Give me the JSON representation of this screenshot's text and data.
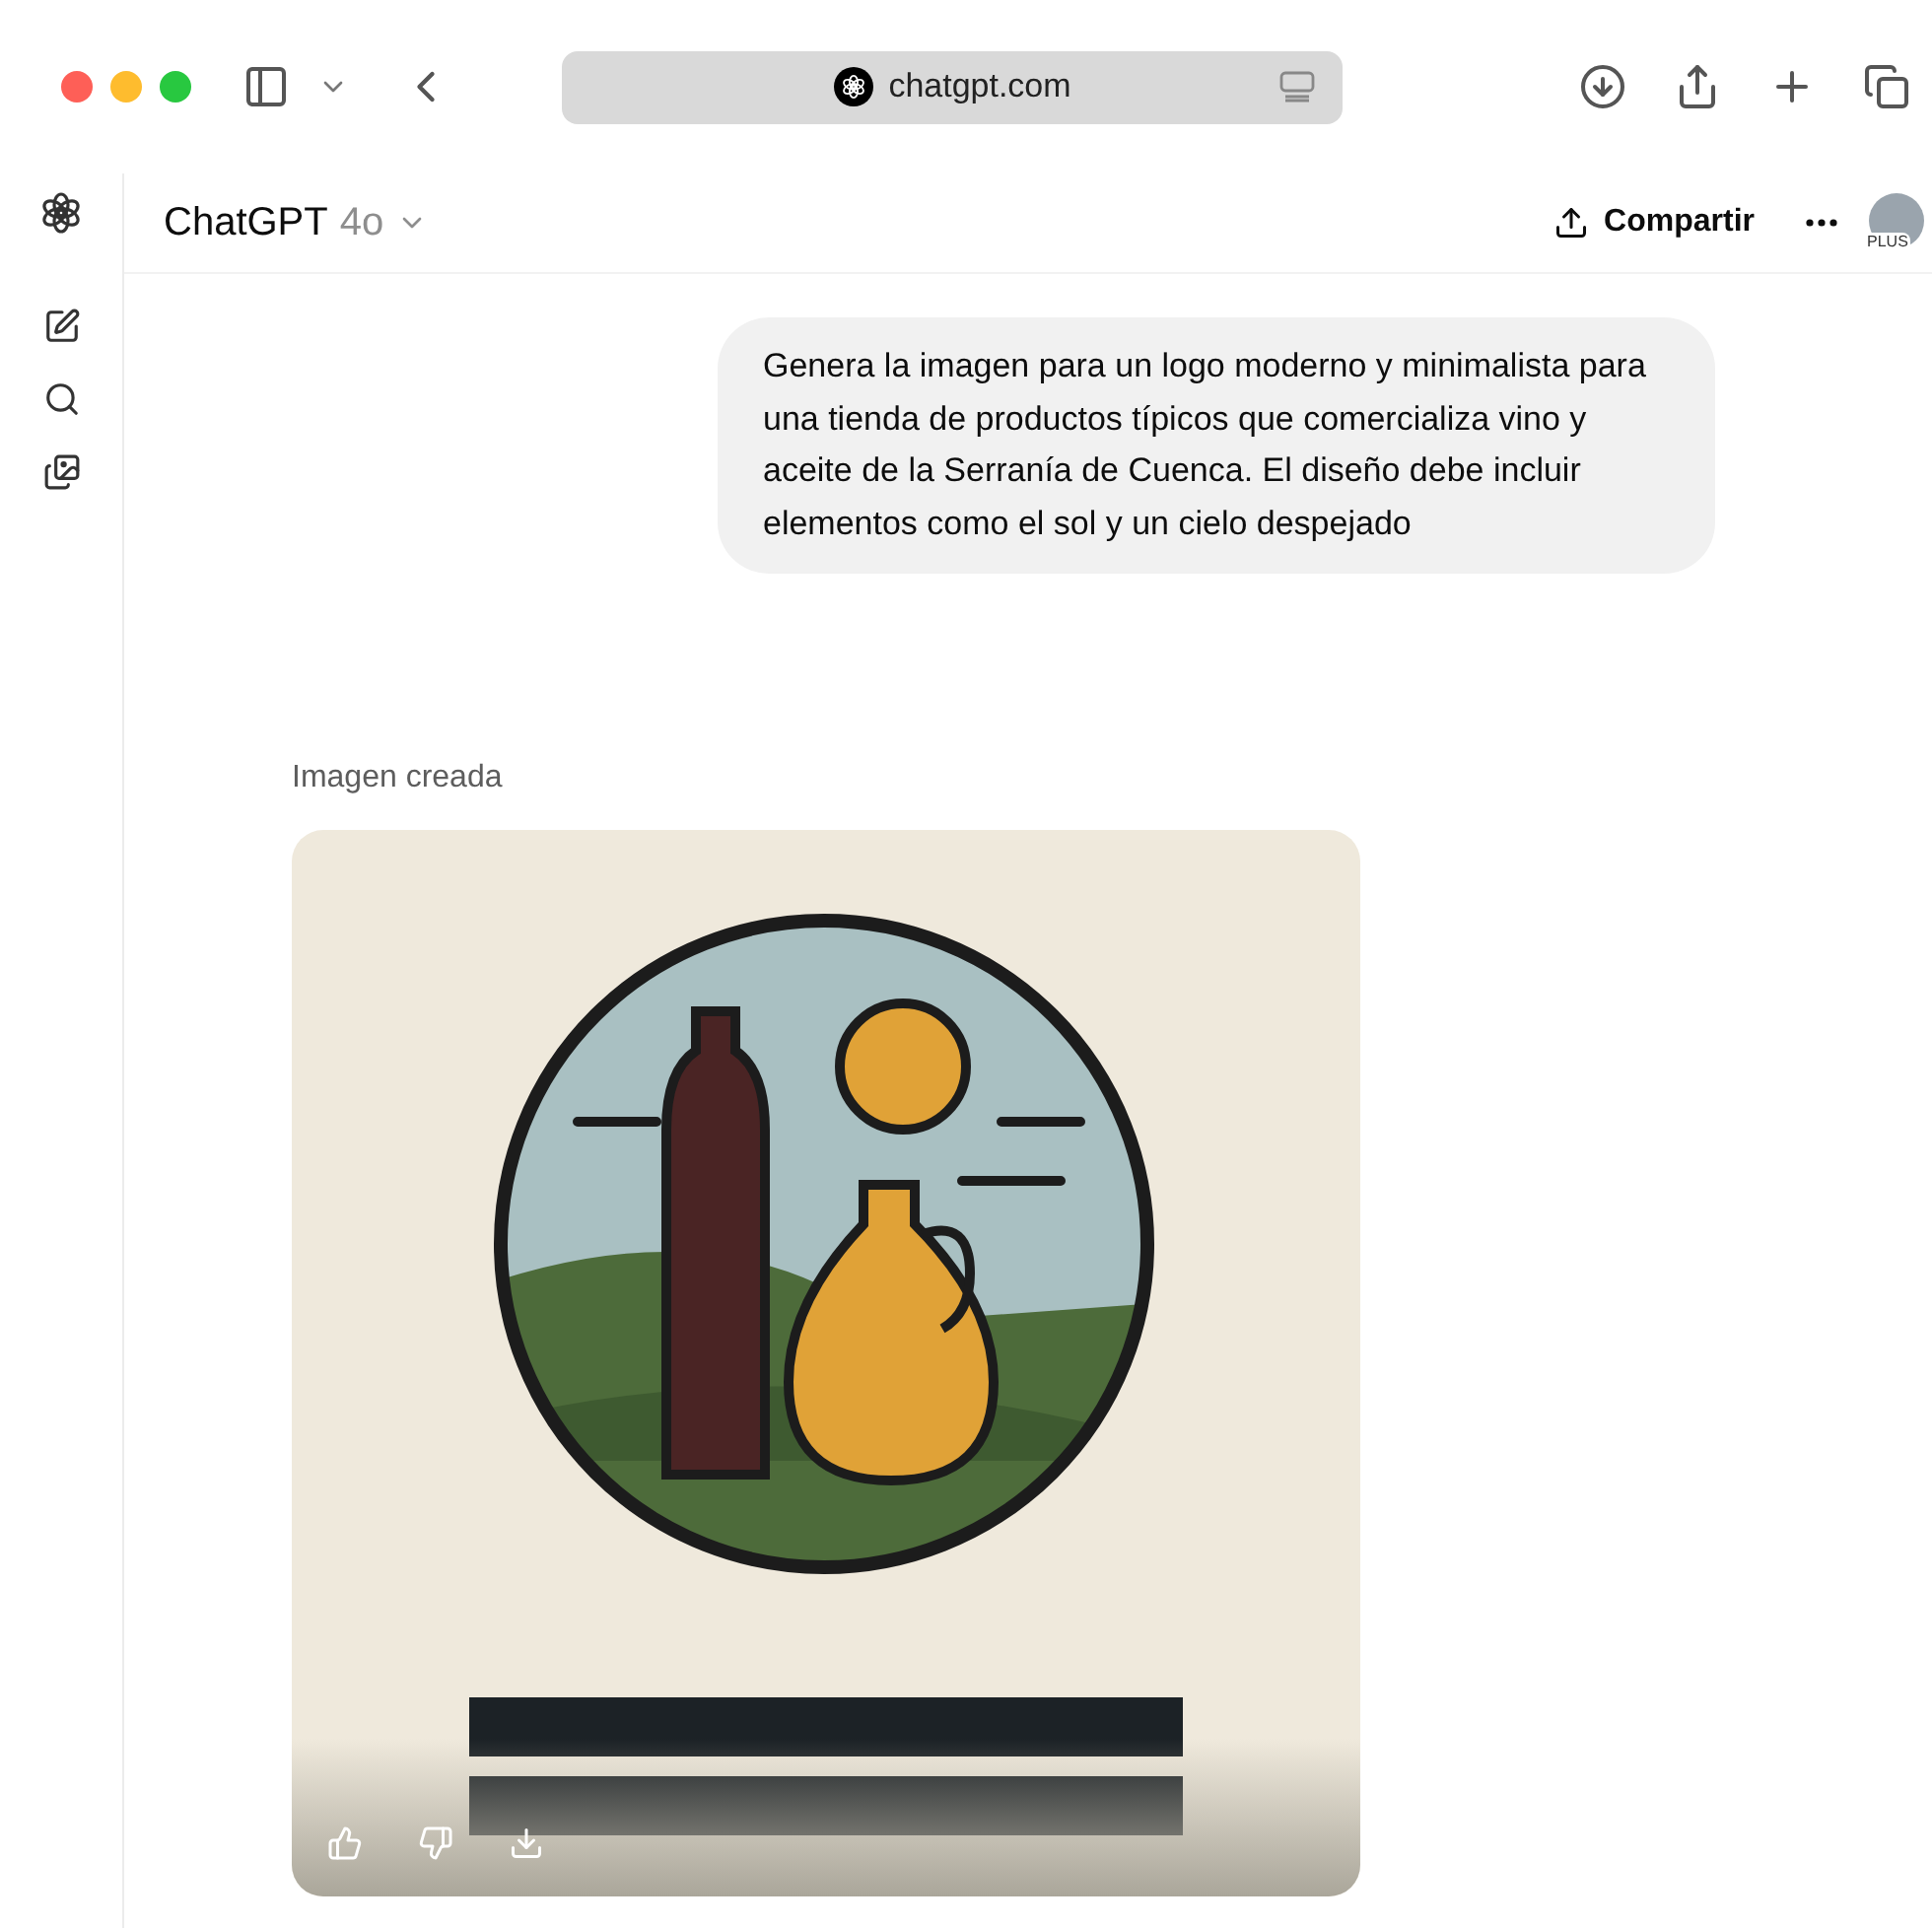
{
  "browser": {
    "address": "chatgpt.com"
  },
  "header": {
    "title": "ChatGPT",
    "model": "4o",
    "share": "Compartir",
    "plan_badge": "PLUS"
  },
  "messages": [
    {
      "kind": "user",
      "text": "Genera la imagen para un logo moderno y minimalista para una tienda de productos típicos que comercializa vino y aceite de la Serranía de Cuenca. El diseño debe incluir elementos como el sol y un cielo despejado"
    },
    {
      "kind": "image",
      "caption": "Imagen creada"
    }
  ]
}
